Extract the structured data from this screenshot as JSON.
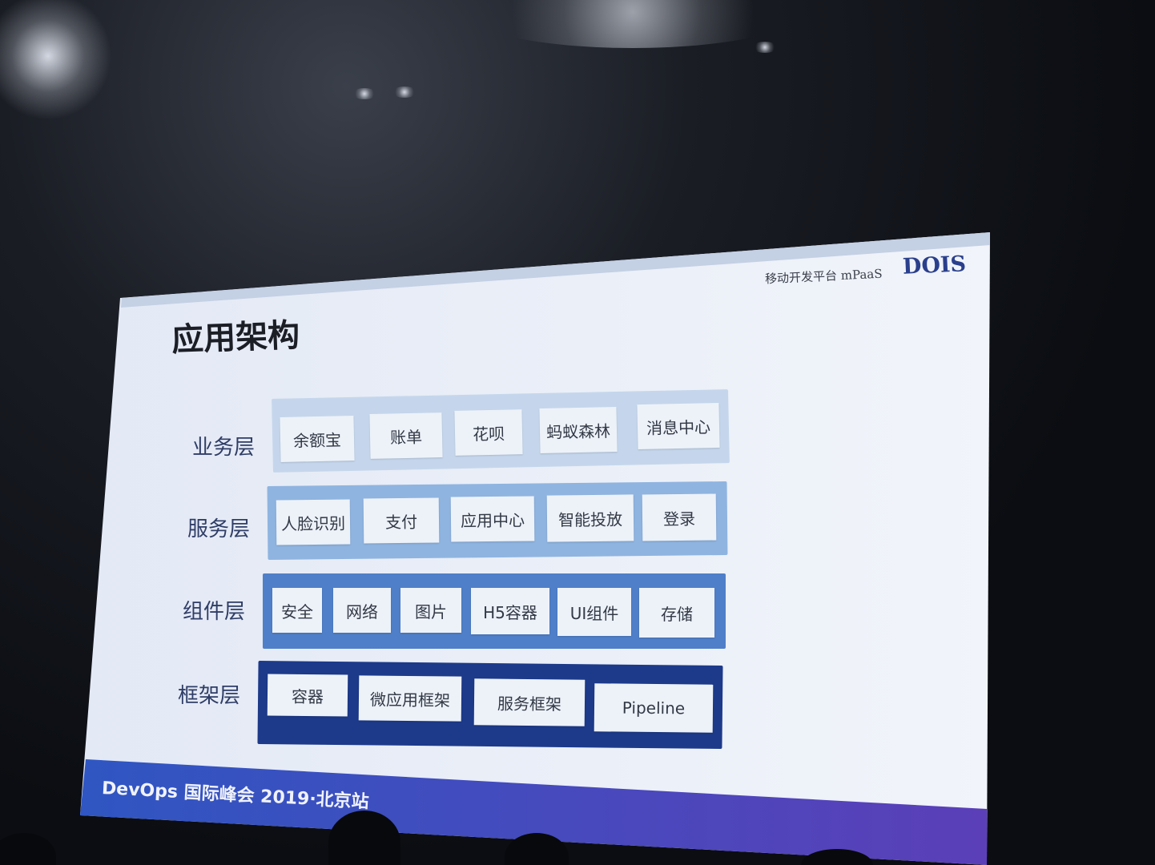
{
  "slide": {
    "brand": "移动开发平台 mPaaS",
    "logo": "DOIS",
    "title": "应用架构",
    "footer": "DevOps 国际峰会 2019·北京站"
  },
  "layers": [
    {
      "label": "业务层",
      "color": "#c5d6ec",
      "items": [
        "余额宝",
        "账单",
        "花呗",
        "蚂蚁森林",
        "消息中心"
      ]
    },
    {
      "label": "服务层",
      "color": "#8fb4e0",
      "items": [
        "人脸识别",
        "支付",
        "应用中心",
        "智能投放",
        "登录"
      ]
    },
    {
      "label": "组件层",
      "color": "#4f7fc8",
      "items": [
        "安全",
        "网络",
        "图片",
        "H5容器",
        "UI组件",
        "存储"
      ]
    },
    {
      "label": "框架层",
      "color": "#1d3a8a",
      "items": [
        "容器",
        "微应用框架",
        "服务框架",
        "Pipeline"
      ]
    }
  ],
  "colors": {
    "footer_band": "#3c4fb5",
    "screen": "#e9eef8"
  }
}
